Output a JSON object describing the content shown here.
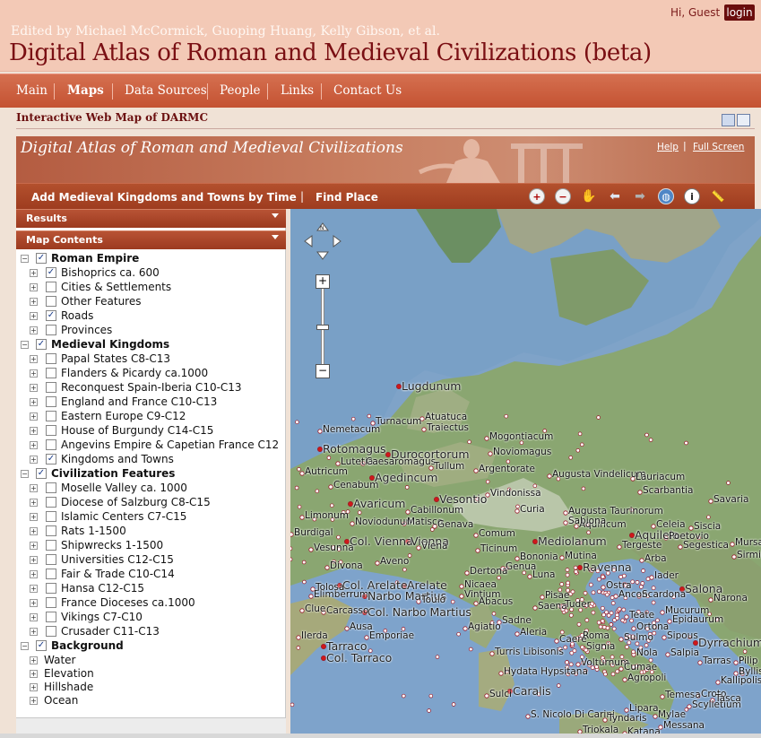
{
  "header": {
    "subtitle": "Edited by Michael McCormick, Guoping Huang, Kelly Gibson, et al.",
    "title": "Digital Atlas of Roman and Medieval Civilizations (beta)",
    "greeting": "Hi, Guest",
    "login_label": "login"
  },
  "nav": {
    "items": [
      {
        "label": "Main"
      },
      {
        "label": "Maps"
      },
      {
        "label": "Data Sources"
      },
      {
        "label": "People"
      },
      {
        "label": "Links"
      },
      {
        "label": "Contact Us"
      }
    ]
  },
  "page": {
    "heading": "Interactive Web Map of DARMC"
  },
  "banner": {
    "title": "Digital Atlas of Roman and Medieval Civilizations",
    "help": "Help",
    "separator": "|",
    "full_screen": "Full Screen"
  },
  "toolbar": {
    "add_kingdoms": "Add Medieval Kingdoms and Towns by Time",
    "separator": "|",
    "find_place": "Find Place"
  },
  "tools": [
    {
      "icon": "zoom-in-icon"
    },
    {
      "icon": "zoom-out-icon"
    },
    {
      "icon": "pan-hand-icon"
    },
    {
      "icon": "back-arrow-icon"
    },
    {
      "icon": "forward-arrow-icon"
    },
    {
      "icon": "full-extent-globe-icon"
    },
    {
      "icon": "info-icon"
    },
    {
      "icon": "measure-ruler-icon"
    }
  ],
  "panel": {
    "results_label": "Results",
    "contents_label": "Map Contents",
    "tree": [
      {
        "label": "Roman Empire",
        "checked": true,
        "level": 0
      },
      {
        "label": "Bishoprics ca. 600",
        "checked": true,
        "level": 1
      },
      {
        "label": "Cities & Settlements",
        "checked": false,
        "level": 1
      },
      {
        "label": "Other Features",
        "checked": false,
        "level": 1
      },
      {
        "label": "Roads",
        "checked": true,
        "level": 1
      },
      {
        "label": "Provinces",
        "checked": false,
        "level": 1
      },
      {
        "label": "Medieval Kingdoms",
        "checked": true,
        "level": 0
      },
      {
        "label": "Papal States C8-C13",
        "checked": false,
        "level": 1
      },
      {
        "label": "Flanders & Picardy ca.1000",
        "checked": false,
        "level": 1
      },
      {
        "label": "Reconquest Spain-Iberia C10-C13",
        "checked": false,
        "level": 1
      },
      {
        "label": "England and France C10-C13",
        "checked": false,
        "level": 1
      },
      {
        "label": "Eastern Europe C9-C12",
        "checked": false,
        "level": 1
      },
      {
        "label": "House of Burgundy C14-C15",
        "checked": false,
        "level": 1
      },
      {
        "label": "Angevins Empire & Capetian France C12",
        "checked": false,
        "level": 1
      },
      {
        "label": "Kingdoms and Towns",
        "checked": true,
        "level": 1
      },
      {
        "label": "Civilization Features",
        "checked": true,
        "level": 0
      },
      {
        "label": "Moselle Valley ca. 1000",
        "checked": false,
        "level": 1
      },
      {
        "label": "Diocese of Salzburg C8-C15",
        "checked": false,
        "level": 1
      },
      {
        "label": "Islamic Centers C7-C15",
        "checked": false,
        "level": 1
      },
      {
        "label": "Rats 1-1500",
        "checked": false,
        "level": 1
      },
      {
        "label": "Shipwrecks 1-1500",
        "checked": false,
        "level": 1
      },
      {
        "label": "Universities C12-C15",
        "checked": false,
        "level": 1
      },
      {
        "label": "Fair & Trade C10-C14",
        "checked": false,
        "level": 1
      },
      {
        "label": "Hansa C12-C15",
        "checked": false,
        "level": 1
      },
      {
        "label": "France Dioceses ca.1000",
        "checked": false,
        "level": 1
      },
      {
        "label": "Vikings C7-C10",
        "checked": false,
        "level": 1
      },
      {
        "label": "Crusader C11-C13",
        "checked": false,
        "level": 1
      },
      {
        "label": "Background",
        "checked": true,
        "level": 0
      },
      {
        "label": "Water",
        "checked": null,
        "level": 1
      },
      {
        "label": "Elevation",
        "checked": null,
        "level": 1
      },
      {
        "label": "Hillshade",
        "checked": null,
        "level": 1
      },
      {
        "label": "Ocean",
        "checked": null,
        "level": 1
      }
    ]
  },
  "map": {
    "labels": [
      "Lugdunum",
      "Nemetacum",
      "Turnacum",
      "Atuatuca",
      "Traiectus",
      "Mogontiacum",
      "Rotomagus",
      "Durocortorum",
      "Noviomagus",
      "Lutetia",
      "Caesaromagus",
      "Tullum",
      "Argentorate",
      "Autricum",
      "Cenabum",
      "Agedincum",
      "Augusta Vindelicum",
      "Lauriacum",
      "Scarbantia",
      "Vindonissa",
      "Vesontio",
      "Curia",
      "Savaria",
      "Avaricum",
      "Aquincum",
      "Noviodunum",
      "Matisco",
      "Cabillonum",
      "Augusta Taurinorum",
      "Limonum",
      "Sabiona",
      "Aquileia",
      "Celeia",
      "Siscia",
      "Tergeste",
      "Poetovio",
      "Segestica",
      "Vesunna",
      "Col. Vienna",
      "Vienna",
      "Genava",
      "Comum",
      "Mediolanum",
      "Ticinum",
      "Mutina",
      "Ravenna",
      "Arba",
      "Iader",
      "Salona",
      "Divona",
      "Dertona",
      "Genua",
      "Bononia",
      "Ostra",
      "Luna",
      "Pisae",
      "Narona",
      "Col. Arelate",
      "Arelate",
      "Nicaea",
      "Vintium",
      "Ancon",
      "Scardona",
      "Elimberrum",
      "Narbo Martius",
      "Col. Narbo Martius",
      "Carcasso",
      "Saena",
      "Tuder",
      "Teate",
      "Mucurum",
      "Epidaurum",
      "Ausa",
      "Emporiae",
      "Agiatio",
      "Sadne",
      "Aleria",
      "Caere",
      "Roma",
      "Signia",
      "Sulmo",
      "Ortona",
      "Ilerda",
      "Tarraco",
      "Col. Tarraco",
      "Turris Libisonis",
      "Volturnum",
      "Nola",
      "Cumae",
      "Salpia",
      "Dyrrachium",
      "Hydata Hypsitana",
      "Agropoli",
      "Tarras",
      "Caralis",
      "Sulci",
      "Temesa",
      "Croto",
      "Scylletium",
      "Kallipolis",
      "S. Nicolo Di Carini",
      "Tyndaris",
      "Lipara",
      "Mylae",
      "Messana",
      "Triokala",
      "Katana",
      "Sipous",
      "Byllis",
      "Mursa",
      "Sirmium",
      "Tolosa",
      "Viena",
      "Clue",
      "Abacus",
      "Aveno",
      "Toulo",
      "Burdigal",
      "Tasca",
      "Pilip"
    ]
  }
}
